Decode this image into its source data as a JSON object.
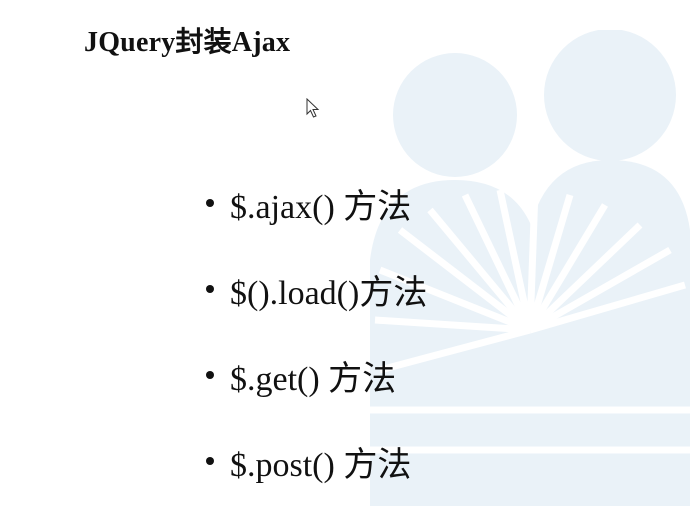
{
  "slide": {
    "title": "JQuery封装Ajax",
    "bullets": [
      {
        "label": "$.ajax() 方法"
      },
      {
        "label": "$().load()方法"
      },
      {
        "label": "$.get() 方法"
      },
      {
        "label": "$.post() 方法"
      }
    ]
  },
  "colors": {
    "text": "#111111",
    "watermark": "#eaf2f8",
    "background": "#ffffff"
  },
  "icons": {
    "cursor": "mouse-pointer-icon",
    "watermark": "people-watermark-icon"
  }
}
